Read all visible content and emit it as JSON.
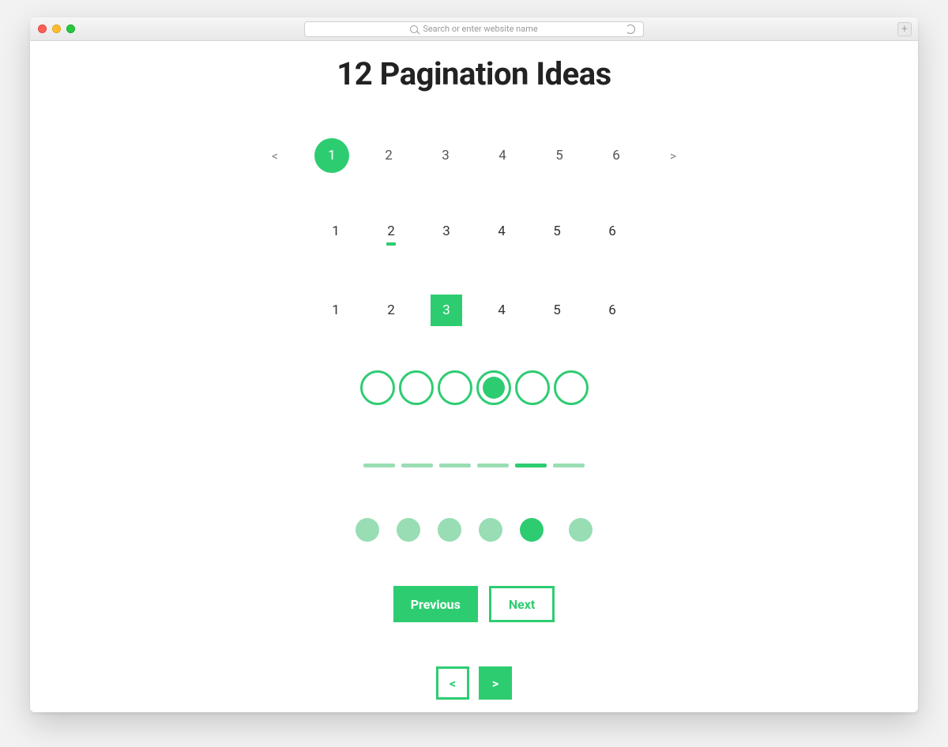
{
  "browser": {
    "placeholder": "Search or enter website name",
    "newtab_label": "+"
  },
  "title": "12 Pagination Ideas",
  "colors": {
    "accent": "#2ecc71"
  },
  "style1": {
    "prev": "<",
    "next": ">",
    "items": [
      "1",
      "2",
      "3",
      "4",
      "5",
      "6"
    ],
    "active_index": 0
  },
  "style2": {
    "items": [
      "1",
      "2",
      "3",
      "4",
      "5",
      "6"
    ],
    "active_index": 1
  },
  "style3": {
    "items": [
      "1",
      "2",
      "3",
      "4",
      "5",
      "6"
    ],
    "active_index": 2
  },
  "style4": {
    "count": 6,
    "active_index": 3
  },
  "style5": {
    "count": 6,
    "active_index": 4
  },
  "style6": {
    "count": 6,
    "active_index": 4
  },
  "style7": {
    "prev_label": "Previous",
    "next_label": "Next"
  },
  "style8": {
    "prev": "<",
    "next": ">"
  }
}
